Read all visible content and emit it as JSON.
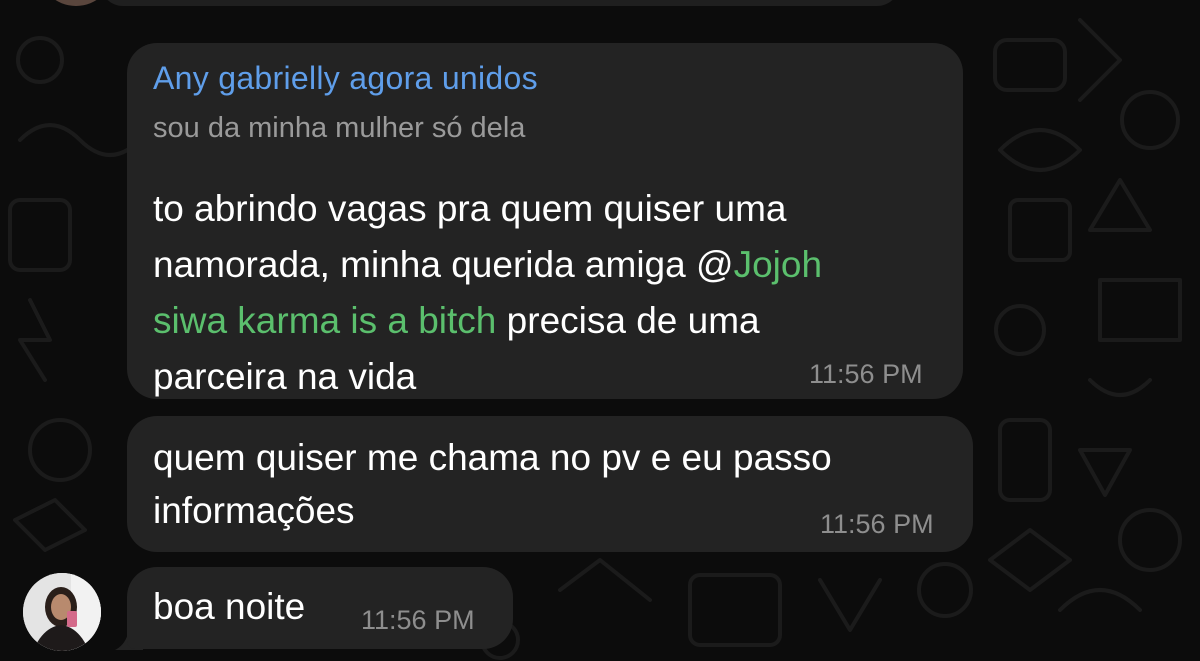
{
  "messages": [
    {
      "sender": "Any gabrielly agora unidos",
      "status": "sou da minha mulher só dela",
      "line1": "to abrindo vagas pra quem quiser uma",
      "line2": "namorada, minha querida amiga ",
      "at": "@",
      "mention_part1": "Jojoh",
      "mention_part2": "siwa karma is a bitch",
      "line3_rest": " precisa de uma",
      "line4": "parceira na vida",
      "time": "11:56 PM"
    },
    {
      "line1": "quem quiser me chama no pv e eu passo",
      "line2": "informações",
      "time": "11:56 PM"
    },
    {
      "line1": "boa noite",
      "time": "11:56 PM"
    }
  ],
  "colors": {
    "sender": "#5f9eea",
    "mention": "#5bbf6d",
    "bubble": "#232323",
    "background": "#0c0c0c"
  },
  "icons": {
    "avatar": "user-avatar-photo"
  }
}
